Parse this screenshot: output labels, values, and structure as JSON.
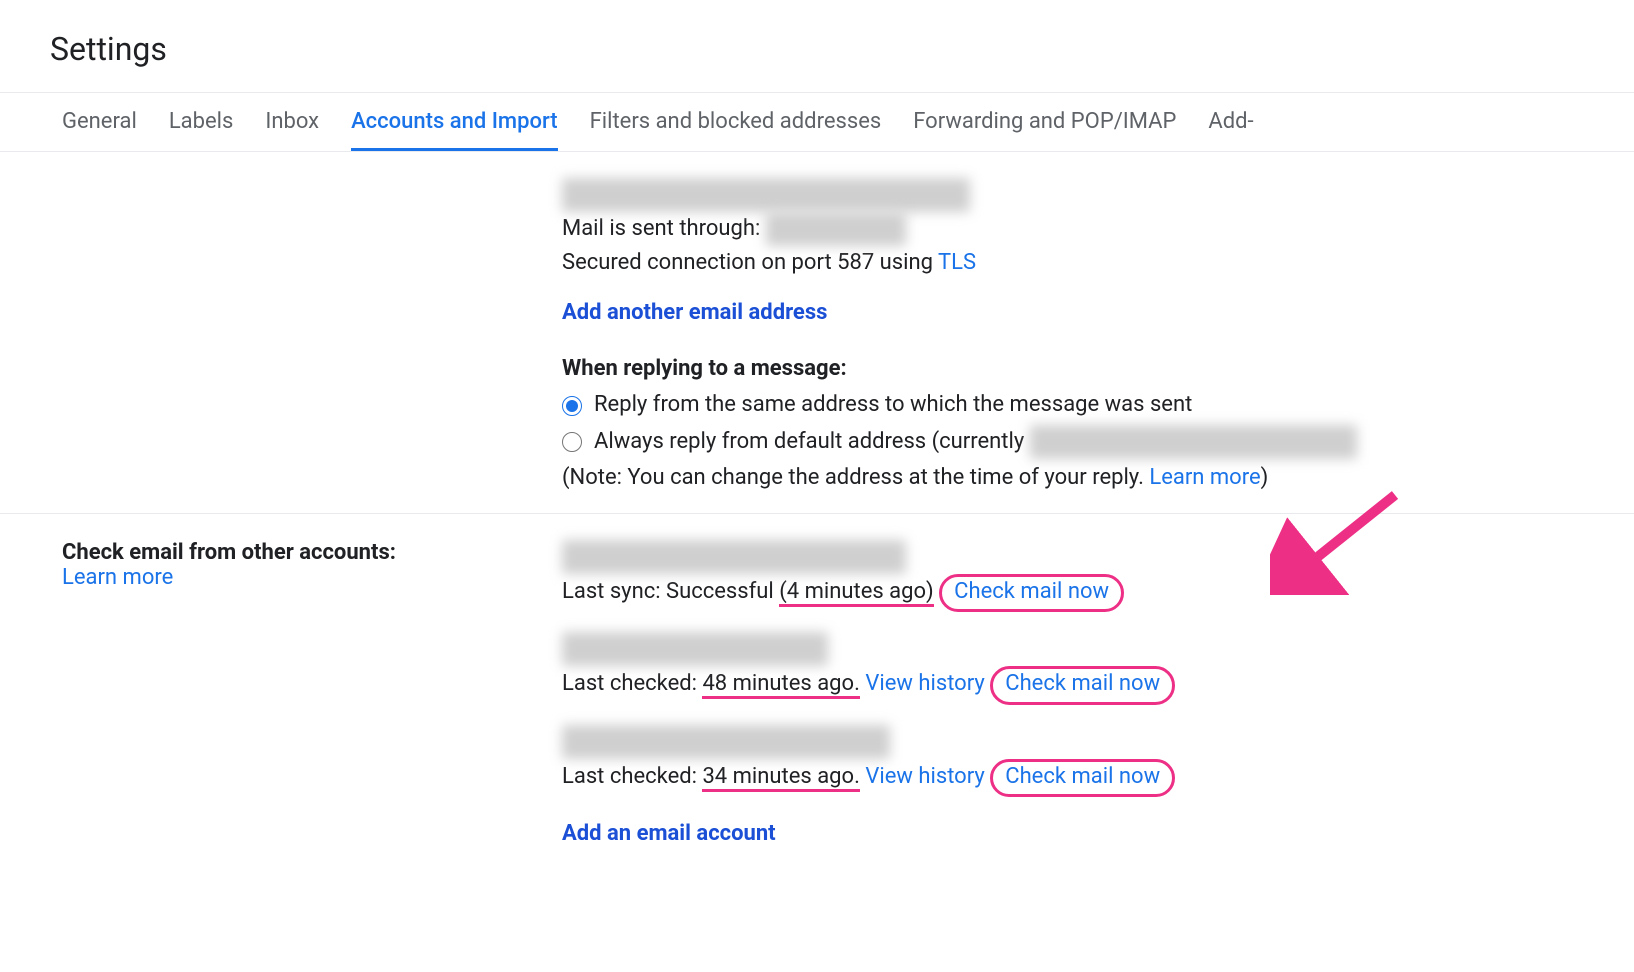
{
  "page": {
    "title": "Settings"
  },
  "tabs": [
    {
      "label": "General"
    },
    {
      "label": "Labels"
    },
    {
      "label": "Inbox"
    },
    {
      "label": "Accounts and Import",
      "active": true
    },
    {
      "label": "Filters and blocked addresses"
    },
    {
      "label": "Forwarding and POP/IMAP"
    },
    {
      "label": "Add-"
    }
  ],
  "send_as": {
    "redacted_name": "████ ████ <████████████████>",
    "mail_sent_through_label": "Mail is sent through: ",
    "redacted_server": "█████████",
    "secured_prefix": "Secured connection on port 587 using ",
    "tls": "TLS",
    "add_another": "Add another email address",
    "reply_heading": "When replying to a message:",
    "reply_option_same": "Reply from the same address to which the message was sent",
    "reply_option_default_prefix": "Always reply from default address (currently ",
    "redacted_default": "█████████████████████",
    "note_prefix": "(Note: You can change the address at the time of your reply. ",
    "learn_more": "Learn more",
    "note_suffix": ")"
  },
  "check_mail": {
    "heading": "Check email from other accounts:",
    "learn_more": "Learn more",
    "accounts": [
      {
        "redacted_addr": "████ ████████ ██ ███████",
        "status_prefix": "Last sync: Successful ",
        "status_time": "(4 minutes ago)",
        "view_history": "",
        "check_now": "Check mail now"
      },
      {
        "redacted_addr": "████ ██████ ██ ████",
        "status_prefix": "Last checked: ",
        "status_time": "48 minutes ago.",
        "view_history": "View history",
        "check_now": "Check mail now"
      },
      {
        "redacted_addr": "█████████ ████ ███ ████",
        "status_prefix": "Last checked: ",
        "status_time": "34 minutes ago.",
        "view_history": "View history",
        "check_now": "Check mail now"
      }
    ],
    "add_account": "Add an email account"
  }
}
